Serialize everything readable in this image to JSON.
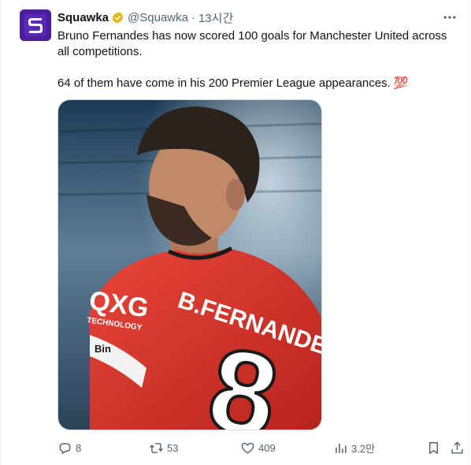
{
  "tweet": {
    "author_name": "Squawka",
    "handle": "@Squawka",
    "separator": "·",
    "time": "13시간",
    "text_line1": "Bruno Fernandes has now scored 100 goals for Manchester United across all competitions.",
    "text_line2": "64 of them have come in his 200 Premier League appearances. 💯",
    "media": {
      "jersey_name": "B.FERNANDES",
      "jersey_number": "8",
      "sponsor_text": "QXG",
      "sponsor_sub": "TECHNOLOGY",
      "armband_text": "Bin"
    }
  },
  "actions": {
    "replies": "8",
    "retweets": "53",
    "likes": "409",
    "views": "3.2만"
  },
  "colors": {
    "brand_avatar": "#4b1e9e",
    "verified_badge": "#e2b719",
    "muted_text": "#536471",
    "jersey_red": "#d8332a"
  }
}
